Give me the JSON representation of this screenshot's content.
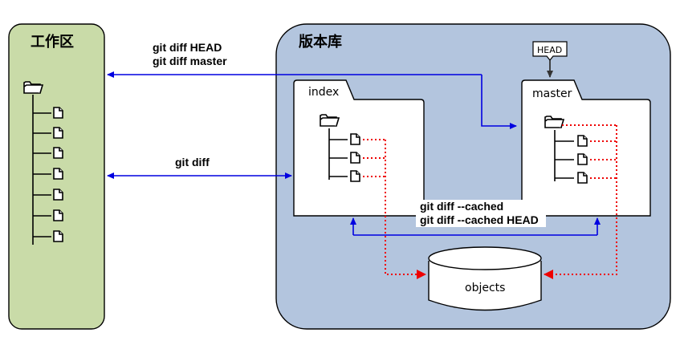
{
  "workspace": {
    "title": "工作区"
  },
  "repository": {
    "title": "版本库"
  },
  "index_panel": {
    "tab_label": "index"
  },
  "master_panel": {
    "tab_label": "master"
  },
  "head_pointer": {
    "label": "HEAD"
  },
  "objects_store": {
    "label": "objects"
  },
  "commands": {
    "diff_head": "git diff HEAD",
    "diff_master": "git diff master",
    "diff": "git diff",
    "diff_cached": "git diff --cached",
    "diff_cached_head": "git diff --cached HEAD"
  },
  "icons": {
    "folder": "folder-icon",
    "file": "file-icon"
  },
  "colors": {
    "workspace_fill": "#c9dba8",
    "repository_fill": "#b3c5de",
    "arrow_blue": "#0000e0",
    "arrow_red": "#ee0000"
  }
}
